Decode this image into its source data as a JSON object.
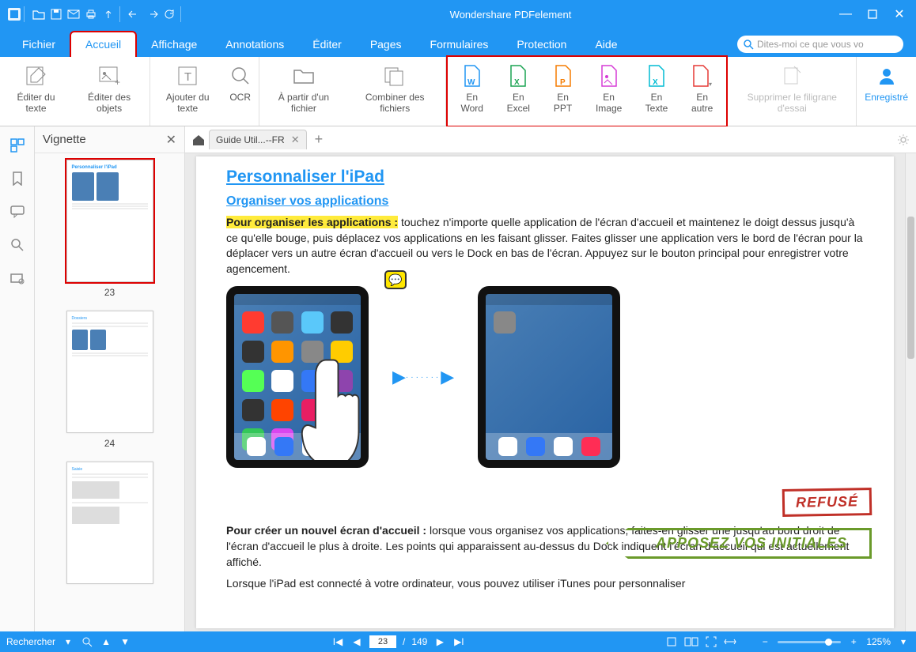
{
  "app": {
    "title": "Wondershare PDFelement"
  },
  "menus": {
    "items": [
      "Fichier",
      "Accueil",
      "Affichage",
      "Annotations",
      "Éditer",
      "Pages",
      "Formulaires",
      "Protection",
      "Aide"
    ],
    "active": "Accueil",
    "search_placeholder": "Dites-moi ce que vous vo"
  },
  "ribbon": {
    "edit_text": "Éditer du texte",
    "edit_obj": "Éditer des objets",
    "add_text": "Ajouter du texte",
    "ocr": "OCR",
    "from_file": "À partir d'un fichier",
    "combine": "Combiner des fichiers",
    "word": "En Word",
    "excel": "En Excel",
    "ppt": "En PPT",
    "image": "En Image",
    "texte": "En Texte",
    "autre": "En autre",
    "watermark": "Supprimer le filigrane d'essai",
    "register": "Enregistré"
  },
  "thumbs": {
    "title": "Vignette",
    "p1": "23",
    "p2": "24"
  },
  "doctab": {
    "name": "Guide Util...--FR"
  },
  "doc": {
    "h2": "Personnaliser l'iPad",
    "h3": "Organiser vos applications",
    "lead": "Pour organiser les applications :",
    "p1": " touchez n'importe quelle application de l'écran d'accueil et maintenez le doigt dessus jusqu'à ce qu'elle bouge, puis déplacez vos applications en les faisant glisser. Faites glisser une application vers le bord de l'écran pour la déplacer vers un autre écran d'accueil ou vers le Dock en bas de l'écran. Appuyez sur le bouton principal pour enregistrer votre agencement.",
    "p2lead": "Pour créer un nouvel écran d'accueil :",
    "p2": " lorsque vous organisez vos applications, faites-en glisser une jusqu'au bord droit de l'écran d'accueil le plus à droite. Les points qui apparaissent au-dessus du Dock indiquent l'écran d'accueil qui est actuellement affiché.",
    "p3": "Lorsque l'iPad est connecté à votre ordinateur, vous pouvez utiliser iTunes pour personnaliser",
    "stamp1": "REFUSÉ",
    "stamp2": "APPOSEZ VOS INITIALES"
  },
  "status": {
    "search": "Rechercher",
    "page": "23",
    "pages": "149",
    "zoom": "125%"
  }
}
